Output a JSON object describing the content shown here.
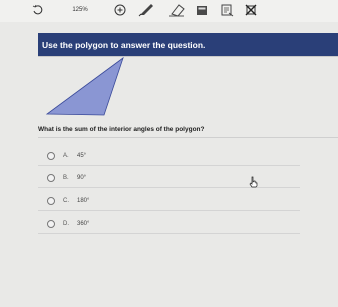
{
  "toolbar": {
    "zoom_label": "125%",
    "tools": [
      "refresh-icon",
      "zoom-in-icon",
      "pen-icon",
      "eraser-icon",
      "calculator-icon",
      "note-icon",
      "eliminate-icon"
    ]
  },
  "banner": {
    "text": "Use the polygon to answer the question."
  },
  "figure": {
    "fill": "#8a96d3",
    "stroke": "#3a4a9a"
  },
  "question": {
    "text": "What is the sum of the interior angles of the polygon?"
  },
  "options": [
    {
      "letter": "A.",
      "text": "45°"
    },
    {
      "letter": "B.",
      "text": "90°"
    },
    {
      "letter": "C.",
      "text": "180°"
    },
    {
      "letter": "D.",
      "text": "360°"
    }
  ]
}
